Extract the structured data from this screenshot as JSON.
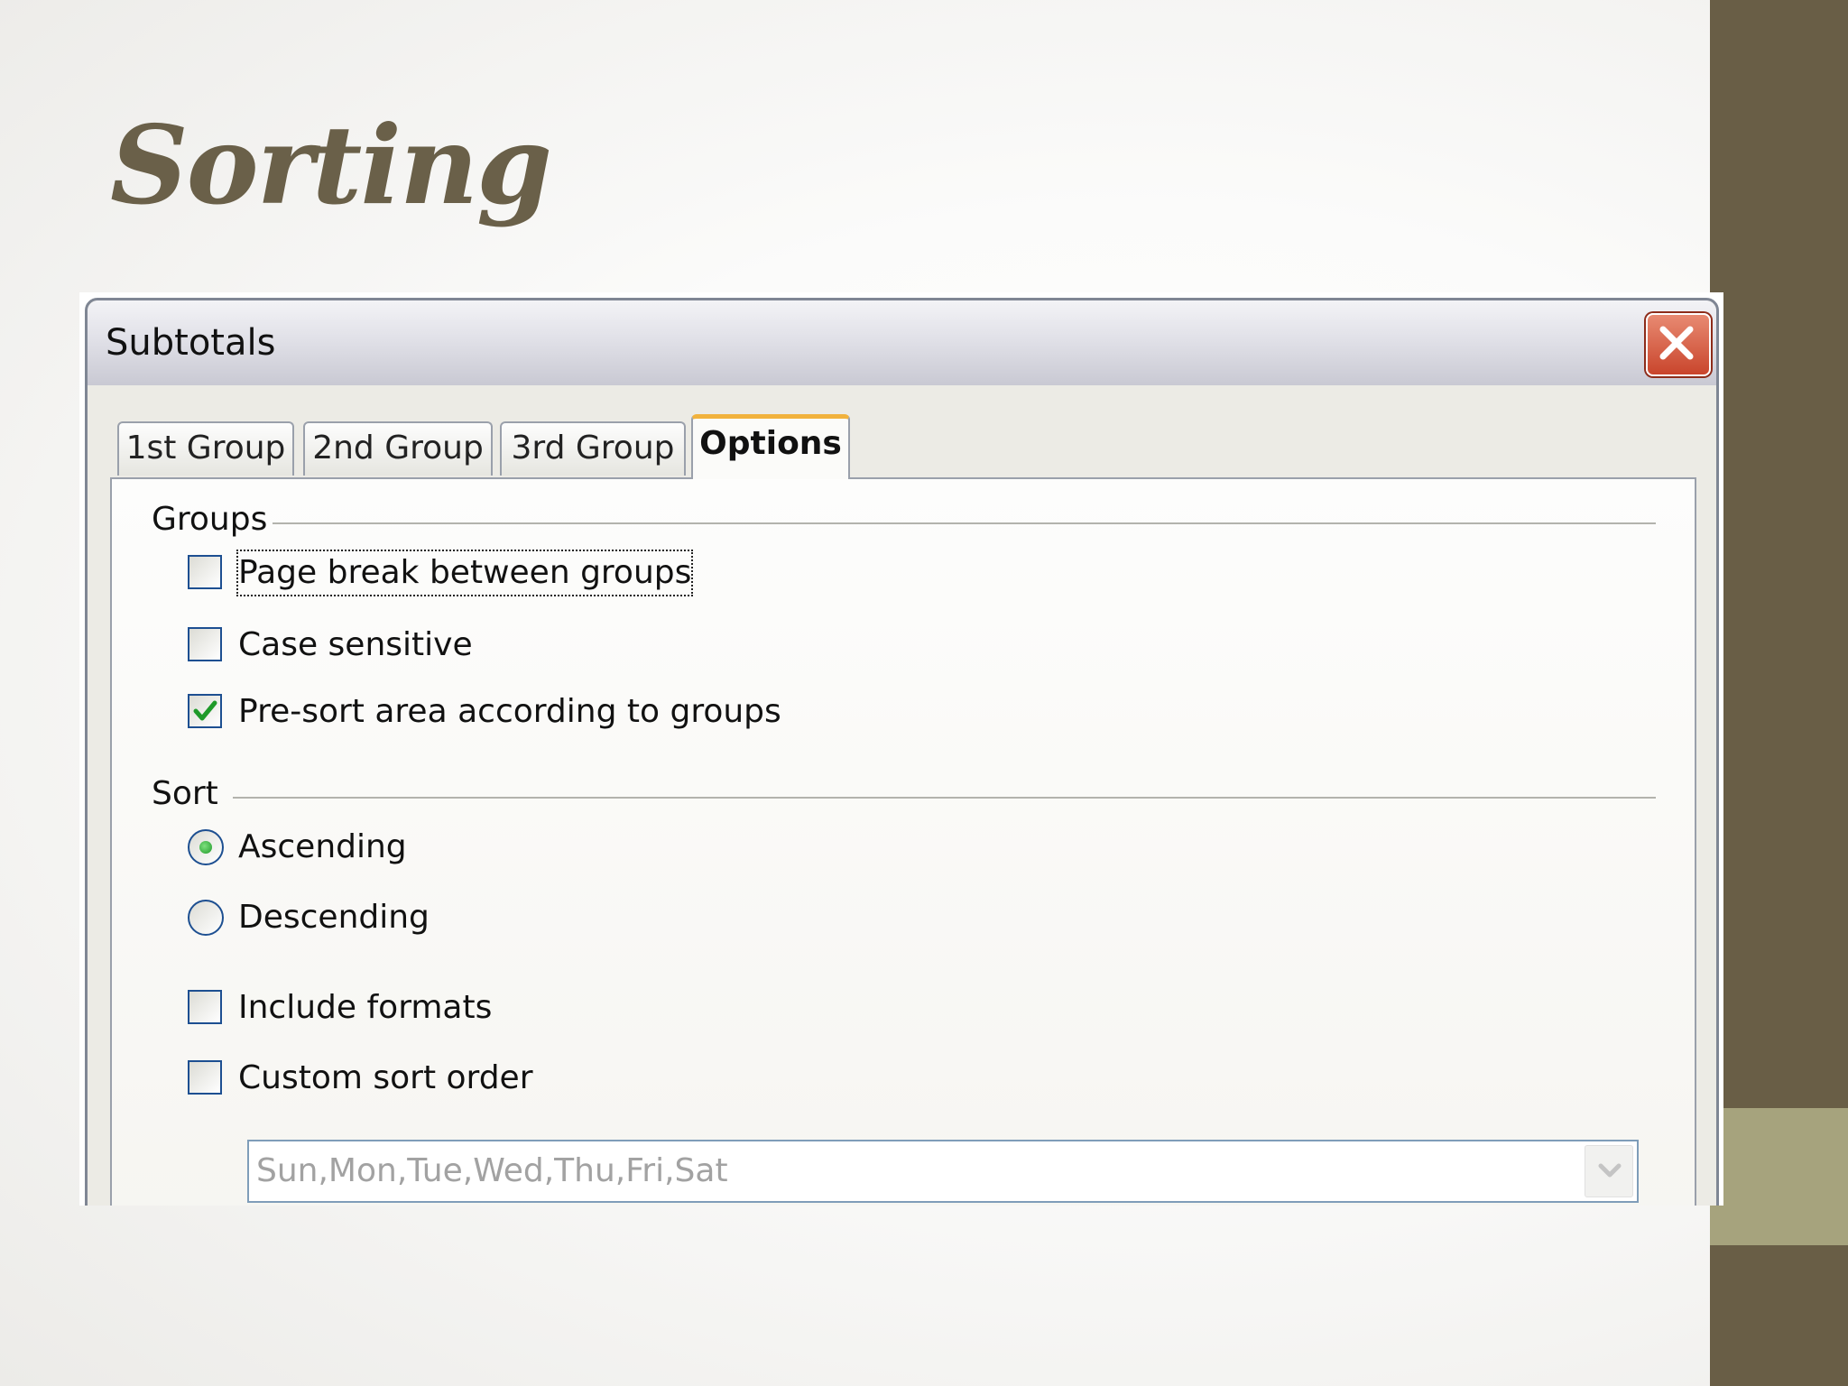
{
  "slide": {
    "title": "Sorting"
  },
  "window": {
    "title": "Subtotals"
  },
  "tabs": [
    {
      "label": "1st Group",
      "active": false
    },
    {
      "label": "2nd Group",
      "active": false
    },
    {
      "label": "3rd Group",
      "active": false
    },
    {
      "label": "Options",
      "active": true
    }
  ],
  "groups_section": {
    "label": "Groups",
    "options": [
      {
        "label": "Page break between groups",
        "checked": false,
        "focused": true
      },
      {
        "label": "Case sensitive",
        "checked": false
      },
      {
        "label": "Pre-sort area according to groups",
        "checked": true
      }
    ]
  },
  "sort_section": {
    "label": "Sort",
    "order": [
      {
        "label": "Ascending",
        "selected": true
      },
      {
        "label": "Descending",
        "selected": false
      }
    ],
    "options": [
      {
        "label": "Include formats",
        "checked": false
      },
      {
        "label": "Custom sort order",
        "checked": false
      }
    ],
    "custom_order_value": "Sun,Mon,Tue,Wed,Thu,Fri,Sat"
  },
  "colors": {
    "accent_dark": "#695e46",
    "accent_light": "#a6a37d",
    "title_color": "#6a6049",
    "active_tab_highlight": "#f1b23d",
    "close_button_red": "#c9452c",
    "check_green": "#1f9a2a"
  },
  "icons": {
    "close": "close-x-icon",
    "checkmark": "checkmark-icon",
    "dropdown": "chevron-down-icon"
  }
}
